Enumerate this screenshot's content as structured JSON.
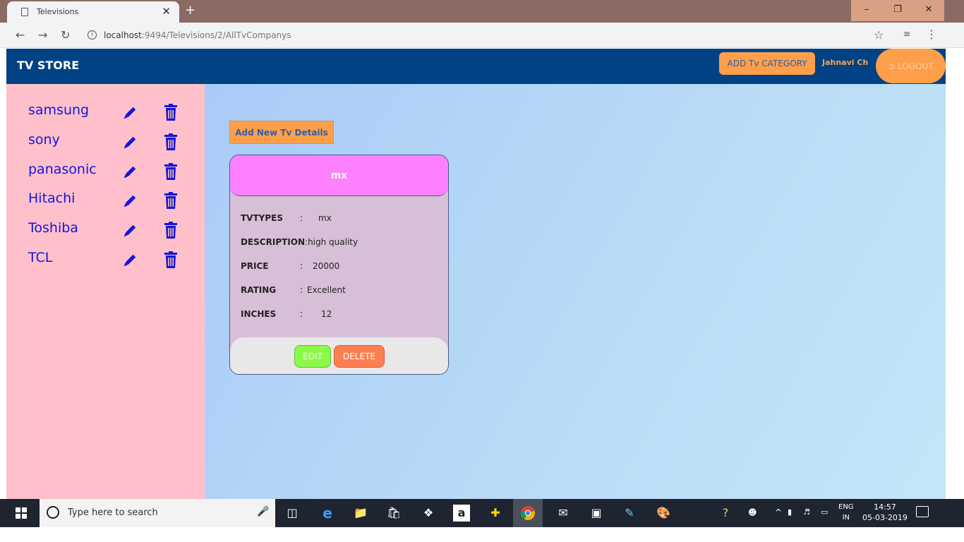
{
  "browser": {
    "tab_title": "Televisions",
    "url_host": "localhost",
    "url_rest": ":9494/Televisions/2/AllTvCompanys"
  },
  "navbar": {
    "brand": "TV STORE",
    "add_category": "ADD Tv CATEGORY",
    "user": "Jahnavi Ch",
    "logout": "LOGOUT"
  },
  "sidebar": {
    "categories": [
      "samsung",
      "sony",
      "panasonic",
      "Hitachi",
      "Toshiba",
      "TCL"
    ]
  },
  "main": {
    "add_button": "Add New Tv Details",
    "card": {
      "title": "mx",
      "rows": [
        {
          "label": "TVTYPES",
          "sep": ":",
          "value": "mx"
        },
        {
          "label": "DESCRIPTION",
          "sep": ":",
          "value": "high quality"
        },
        {
          "label": "PRICE",
          "sep": ":",
          "value": "20000"
        },
        {
          "label": "RATING",
          "sep": ":",
          "value": "Excellent"
        },
        {
          "label": "INCHES",
          "sep": ":",
          "value": "12"
        }
      ],
      "edit": "EDIT",
      "delete": "DELETE"
    }
  },
  "taskbar": {
    "search_placeholder": "Type here to search",
    "lang_top": "ENG",
    "lang_bottom": "IN",
    "time": "14:57",
    "date": "05-03-2019"
  },
  "colors": {
    "navbar": "#004283",
    "sidebar": "#ffc0cb",
    "accent": "#ff9f4a",
    "card_header": "#ff80ff",
    "card_body": "#d8bfd8",
    "category_text": "#1515d8"
  }
}
